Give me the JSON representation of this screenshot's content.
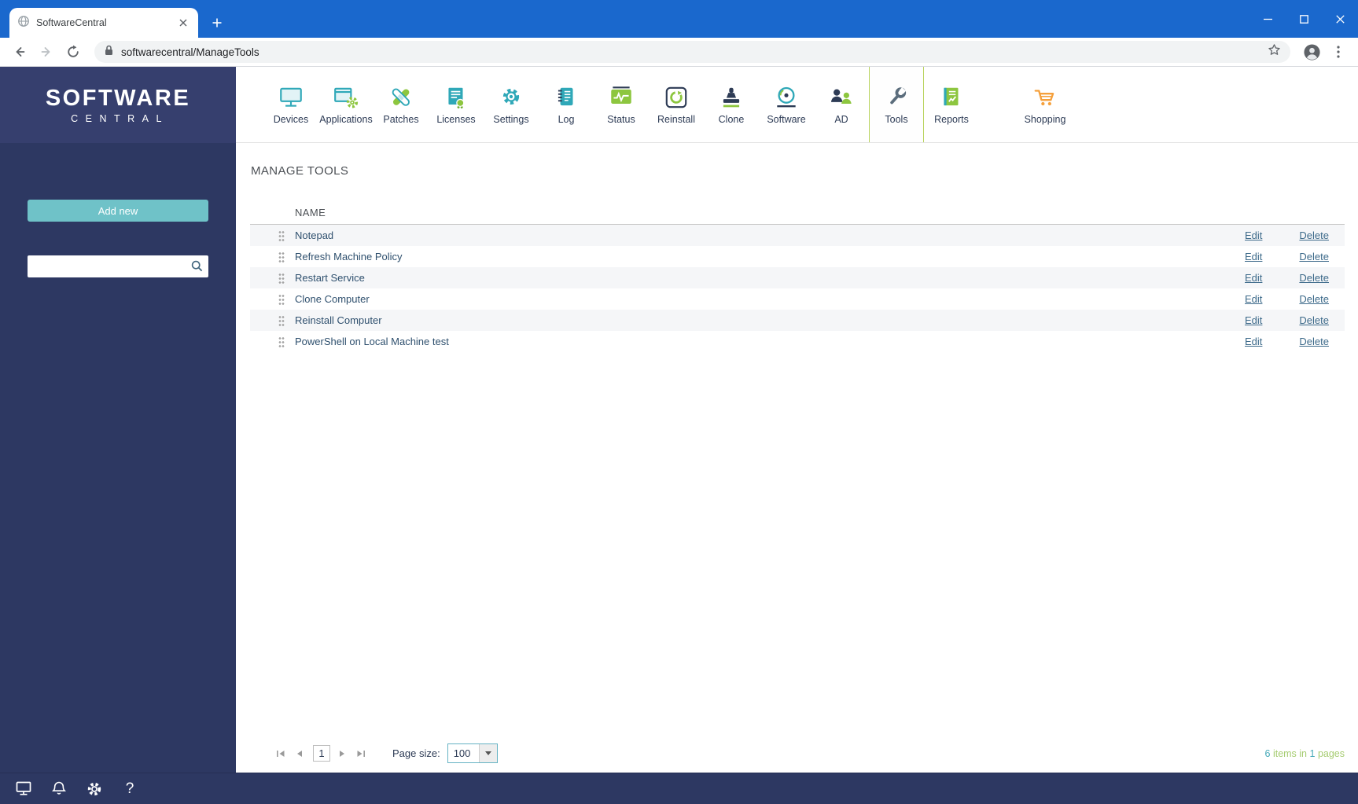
{
  "browser": {
    "tab_title": "SoftwareCentral",
    "url": "softwarecentral/ManageTools"
  },
  "sidebar": {
    "logo_line1": "SOFTWARE",
    "logo_line2": "CENTRAL",
    "add_new_label": "Add new",
    "search_placeholder": "",
    "bottom_icons": [
      "monitor-icon",
      "bell-icon",
      "gear-icon",
      "help-icon"
    ]
  },
  "topnav": {
    "active_item": "Tools",
    "items": [
      {
        "label": "Devices",
        "icon": "devices-icon"
      },
      {
        "label": "Applications",
        "icon": "applications-icon"
      },
      {
        "label": "Patches",
        "icon": "patches-icon"
      },
      {
        "label": "Licenses",
        "icon": "licenses-icon"
      },
      {
        "label": "Settings",
        "icon": "settings-icon"
      },
      {
        "label": "Log",
        "icon": "log-icon"
      },
      {
        "label": "Status",
        "icon": "status-icon"
      },
      {
        "label": "Reinstall",
        "icon": "reinstall-icon"
      },
      {
        "label": "Clone",
        "icon": "clone-icon"
      },
      {
        "label": "Software",
        "icon": "software-icon"
      },
      {
        "label": "AD",
        "icon": "ad-icon"
      },
      {
        "label": "Tools",
        "icon": "tools-icon"
      },
      {
        "label": "Reports",
        "icon": "reports-icon"
      },
      {
        "label": "Shopping",
        "icon": "shopping-icon"
      }
    ]
  },
  "main": {
    "title": "MANAGE TOOLS",
    "table": {
      "name_header": "NAME",
      "actions": {
        "edit": "Edit",
        "delete": "Delete"
      },
      "rows": [
        {
          "name": "Notepad"
        },
        {
          "name": "Refresh Machine Policy"
        },
        {
          "name": "Restart Service"
        },
        {
          "name": "Clone Computer"
        },
        {
          "name": "Reinstall Computer"
        },
        {
          "name": "PowerShell on Local Machine test"
        }
      ]
    },
    "pagination": {
      "page_size_label": "Page size:",
      "page_size_value": "100",
      "current_page": "1",
      "summary": {
        "items_count": "6",
        "items_text": "items in",
        "pages_count": "1",
        "pages_text": "pages"
      }
    }
  },
  "colors": {
    "chrome_blue": "#1a68cd",
    "navy": "#2d3862",
    "brand_teal": "#2fa8b8",
    "brand_green": "#8dc63f",
    "shopping_orange": "#f5a03c",
    "link_blue": "#3d6a8a"
  }
}
